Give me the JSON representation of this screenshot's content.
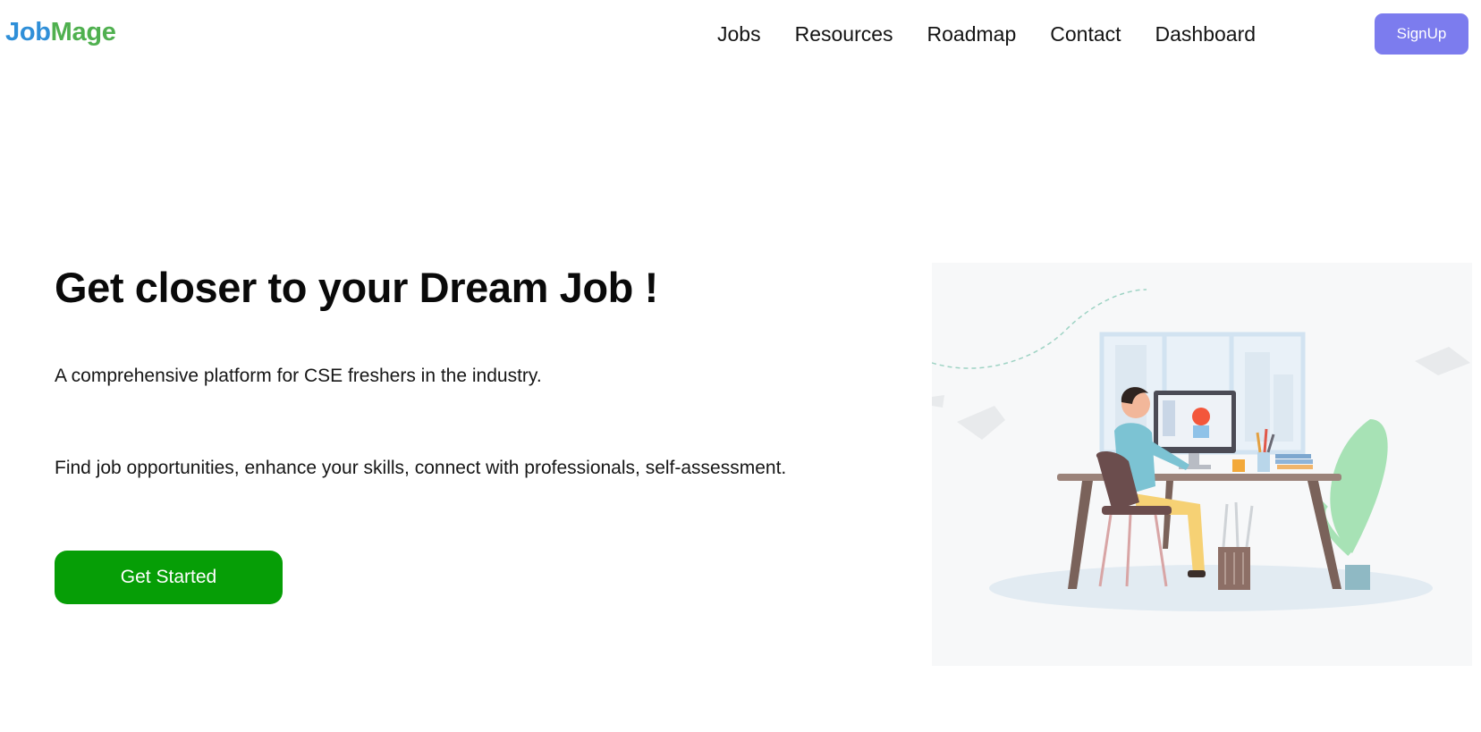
{
  "brand": {
    "part1": "Job",
    "part2": "Mage",
    "colors": {
      "part1": "#2f8fd8",
      "part2": "#4fb04f"
    }
  },
  "nav": {
    "links": [
      "Jobs",
      "Resources",
      "Roadmap",
      "Contact",
      "Dashboard"
    ],
    "signup_label": "SignUp",
    "signup_color": "#7c7cee"
  },
  "hero": {
    "title": "Get closer to your Dream Job !",
    "subtitle": "A comprehensive platform for CSE freshers in the industry.",
    "features": "Find job opportunities, enhance your skills, connect with professionals, self-assessment.",
    "cta_label": "Get Started",
    "cta_color": "#069e06"
  },
  "illustration": {
    "icon": "person-working-at-desk-illustration"
  }
}
